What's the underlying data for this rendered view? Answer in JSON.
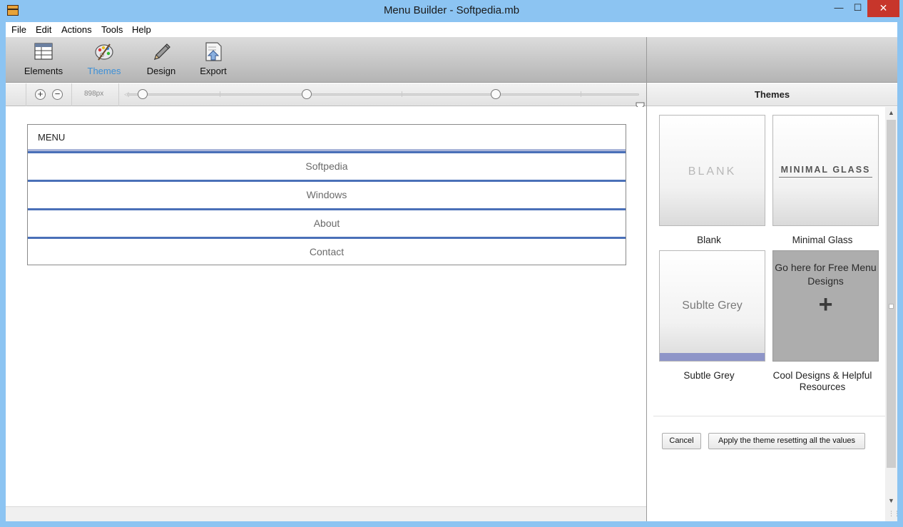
{
  "window": {
    "title": "Menu Builder - Softpedia.mb"
  },
  "menubar": {
    "items": [
      "File",
      "Edit",
      "Actions",
      "Tools",
      "Help"
    ]
  },
  "toolbar": {
    "elements_label": "Elements",
    "themes_label": "Themes",
    "design_label": "Design",
    "export_label": "Export",
    "active": "Themes"
  },
  "zoom": {
    "value_label": "898px"
  },
  "preview": {
    "header": "MENU",
    "items": [
      "Softpedia",
      "Windows",
      "About",
      "Contact"
    ],
    "rule_color": "#4a70b8"
  },
  "themes_panel": {
    "title": "Themes",
    "themes": [
      {
        "name": "Blank",
        "thumb_text": "BLANK"
      },
      {
        "name": "Minimal Glass",
        "thumb_text": "MINIMAL GLASS"
      },
      {
        "name": "Subtle Grey",
        "thumb_text": "Sublte Grey"
      },
      {
        "name": "Cool Designs & Helpful Resources",
        "thumb_text": "Go here for Free Menu Designs",
        "thumb_icon": "plus-icon"
      }
    ],
    "cancel_label": "Cancel",
    "apply_label": "Apply the theme resetting all the values"
  },
  "colors": {
    "titlebar": "#8cc4f2",
    "close_button": "#c7362b",
    "active_tool": "#3c8fd6"
  }
}
